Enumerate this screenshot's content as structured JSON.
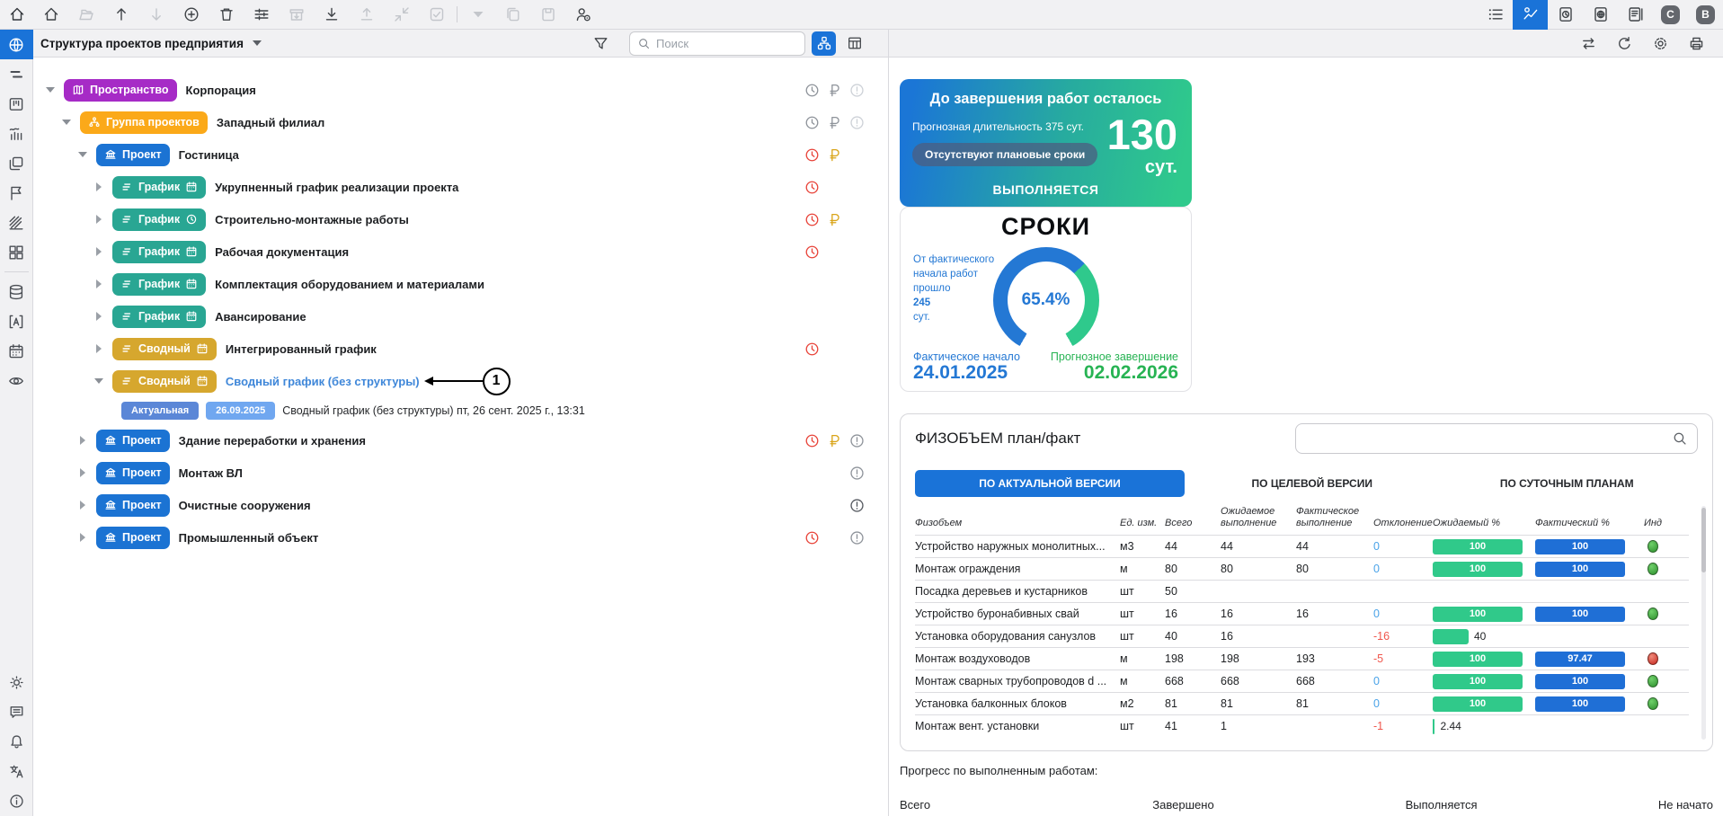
{
  "colors": {
    "accent_blue": "#1a73d8",
    "badge_purple": "#a62bc6",
    "badge_orange": "#fba919",
    "badge_blue": "#1b73d3",
    "badge_teal": "#29a693",
    "badge_gold": "#d6a72e",
    "version_badge1": "#5b87d7",
    "version_badge2": "#70a7f0",
    "link_blue": "#3f87d9",
    "status_red": "#e8443a",
    "status_grey": "#8e939a",
    "status_gold": "#d9a418",
    "warn_light": "#cdd1d7",
    "warn_grey": "#aeb3ba",
    "warn_dark": "#54585f",
    "grad_from": "#1b76d6",
    "grad_to": "#2fc98c",
    "pill_bg": "rgba(76,94,128,0.75)",
    "bar_green": "#30c98a",
    "bar_blue": "#1f6fd6",
    "blue_text": "#2478d4",
    "green_text": "#27b353"
  },
  "topbar": {
    "left": [
      {
        "name": "home",
        "state": "on"
      },
      {
        "name": "folder-open",
        "state": "off"
      },
      {
        "name": "arrow-up",
        "state": "on"
      },
      {
        "name": "arrow-down",
        "state": "off"
      },
      {
        "name": "plus-circle",
        "state": "on"
      },
      {
        "name": "trash",
        "state": "on"
      },
      {
        "name": "sliders",
        "state": "on"
      },
      {
        "name": "box-down",
        "state": "off"
      },
      {
        "name": "download",
        "state": "on"
      },
      {
        "name": "upload",
        "state": "off"
      },
      {
        "name": "collapse",
        "state": "off"
      },
      {
        "name": "checkbox",
        "state": "off"
      },
      {
        "name": "divider"
      },
      {
        "name": "caret-down",
        "state": "off",
        "small": true
      },
      {
        "name": "copy",
        "state": "off"
      },
      {
        "name": "paste",
        "state": "off"
      },
      {
        "name": "user-gear",
        "state": "on"
      }
    ],
    "right": [
      {
        "name": "list",
        "state": "on"
      },
      {
        "name": "chart-line",
        "state": "active"
      },
      {
        "name": "doc-clock",
        "state": "on"
      },
      {
        "name": "doc-globe",
        "state": "on"
      },
      {
        "name": "doc-report",
        "state": "on"
      },
      {
        "name": "badge",
        "letter": "C"
      },
      {
        "name": "badge",
        "letter": "B"
      }
    ]
  },
  "sidebar": {
    "top": [
      {
        "name": "globe",
        "active": true
      },
      {
        "name": "gantt"
      },
      {
        "name": "kanban"
      },
      {
        "name": "chart-wave"
      },
      {
        "name": "folders"
      },
      {
        "name": "flag"
      },
      {
        "name": "hatch"
      },
      {
        "name": "grid"
      },
      {
        "divider": true
      },
      {
        "name": "db"
      },
      {
        "name": "brackets-a"
      },
      {
        "name": "calendar"
      },
      {
        "name": "eye"
      }
    ],
    "bottom": [
      {
        "name": "sun"
      },
      {
        "name": "comment"
      },
      {
        "name": "bell"
      },
      {
        "name": "translate"
      },
      {
        "name": "info"
      }
    ]
  },
  "tree_panel": {
    "title": "Структура проектов предприятия",
    "search_placeholder": "Поиск",
    "annotation_label": "1",
    "rows": [
      {
        "lvl": 0,
        "caret": "down",
        "badge": "Пространство",
        "color": "badge_purple",
        "icon": "map",
        "name": "Корпорация",
        "status": {
          "clock": "grey",
          "ruble": "grey",
          "warn": "light"
        }
      },
      {
        "lvl": 1,
        "caret": "down",
        "badge": "Группа проектов",
        "color": "badge_orange",
        "icon": "hierarchy",
        "name": "Западный филиал",
        "status": {
          "clock": "grey",
          "ruble": "grey",
          "warn": "light"
        }
      },
      {
        "lvl": 2,
        "caret": "down",
        "badge": "Проект",
        "color": "badge_blue",
        "icon": "bank",
        "name": "Гостиница",
        "status": {
          "clock": "red",
          "ruble": "gold"
        }
      },
      {
        "lvl": 3,
        "caret": "right",
        "badge": "График",
        "color": "badge_teal",
        "icon": "bars",
        "icon2": "calendar",
        "name": "Укрупненный график реализации проекта",
        "status": {
          "clock": "red"
        }
      },
      {
        "lvl": 3,
        "caret": "right",
        "badge": "График",
        "color": "badge_teal",
        "icon": "bars",
        "icon2": "clock-small",
        "name": "Строительно-монтажные работы",
        "status": {
          "clock": "red",
          "ruble": "gold"
        }
      },
      {
        "lvl": 3,
        "caret": "right",
        "badge": "График",
        "color": "badge_teal",
        "icon": "bars",
        "icon2": "calendar",
        "name": "Рабочая документация",
        "status": {
          "clock": "red"
        }
      },
      {
        "lvl": 3,
        "caret": "right",
        "badge": "График",
        "color": "badge_teal",
        "icon": "bars",
        "icon2": "calendar",
        "name": "Комплектация оборудованием и материалами"
      },
      {
        "lvl": 3,
        "caret": "right",
        "badge": "График",
        "color": "badge_teal",
        "icon": "bars",
        "icon2": "calendar",
        "name": "Авансирование"
      },
      {
        "lvl": 3,
        "caret": "right",
        "badge": "Сводный",
        "color": "badge_gold",
        "icon": "bars",
        "icon2": "calendar",
        "name": "Интегрированный график",
        "status": {
          "clock": "red"
        }
      },
      {
        "lvl": 3,
        "caret": "down",
        "badge": "Сводный",
        "color": "badge_gold",
        "icon": "bars",
        "icon2": "calendar",
        "name": "Сводный график (без структуры)",
        "link": true,
        "annotation": "1"
      },
      {
        "lvl": 4,
        "version": true,
        "badge1": "Актуальная",
        "badge2": "26.09.2025",
        "name": "Сводный график (без структуры) пт, 26 сент. 2025 г., 13:31"
      },
      {
        "lvl": 2,
        "caret": "right",
        "badge": "Проект",
        "color": "badge_blue",
        "icon": "bank",
        "name": "Здание переработки и хранения",
        "status": {
          "clock": "red",
          "ruble": "gold",
          "warn": "grey"
        }
      },
      {
        "lvl": 2,
        "caret": "right",
        "badge": "Проект",
        "color": "badge_blue",
        "icon": "bank",
        "name": "Монтаж ВЛ",
        "status": {
          "warn": "grey"
        }
      },
      {
        "lvl": 2,
        "caret": "right",
        "badge": "Проект",
        "color": "badge_blue",
        "icon": "bank",
        "name": "Очистные сооружения",
        "status": {
          "warn": "dark"
        }
      },
      {
        "lvl": 2,
        "caret": "right",
        "badge": "Проект",
        "color": "badge_blue",
        "icon": "bank",
        "name": "Промышленный объект",
        "status": {
          "clock": "red",
          "warn": "grey"
        }
      }
    ]
  },
  "dashboard": {
    "countdown": {
      "title": "До завершения работ осталось",
      "forecast": "Прогнозная длительность 375 сут.",
      "pill": "Отсутствуют плановые сроки",
      "days": "130",
      "days_unit": "сут.",
      "status": "ВЫПОЛНЯЕТСЯ"
    },
    "sroki": {
      "title": "СРОКИ",
      "left_lines": [
        "От фактического",
        "начала работ",
        "прошло"
      ],
      "elapsed": "245",
      "elapsed_unit": "сут.",
      "percent": 65.4,
      "percent_label": "65.4%",
      "start_label": "Фактическое начало",
      "start_date": "24.01.2025",
      "end_label": "Прогнозное завершение",
      "end_date": "02.02.2026"
    },
    "fizobem": {
      "title": "ФИЗОБЪЕМ план/факт",
      "search_value": "",
      "tabs": [
        {
          "label": "ПО АКТУАЛЬНОЙ ВЕРСИИ",
          "active": true
        },
        {
          "label": "ПО ЦЕЛЕВОЙ ВЕРСИИ",
          "active": false
        },
        {
          "label": "ПО СУТОЧНЫМ ПЛАНАМ",
          "active": false
        }
      ],
      "columns": [
        "Физобъем",
        "Ед. изм.",
        "Всего",
        "Ожидаемое\nвыполнение",
        "Фактическое\nвыполнение",
        "Отклонение",
        "Ожидаемый %",
        "Фактический %",
        "Инд"
      ],
      "rows": [
        {
          "name": "Устройство наружных монолитных...",
          "unit": "м3",
          "total": "44",
          "expected": "44",
          "actual": "44",
          "deviation": "0",
          "expected_pct": 100,
          "actual_pct": 100,
          "actual_pct_label": "100",
          "ind": "green"
        },
        {
          "name": "Монтаж ограждения",
          "unit": "м",
          "total": "80",
          "expected": "80",
          "actual": "80",
          "deviation": "0",
          "expected_pct": 100,
          "actual_pct": 100,
          "actual_pct_label": "100",
          "ind": "green"
        },
        {
          "name": "Посадка деревьев и кустарников",
          "unit": "шт",
          "total": "50",
          "expected": "",
          "actual": "",
          "deviation": "",
          "expected_pct": null,
          "actual_pct": null,
          "ind": null
        },
        {
          "name": "Устройство буронабивных свай",
          "unit": "шт",
          "total": "16",
          "expected": "16",
          "actual": "16",
          "deviation": "0",
          "expected_pct": 100,
          "actual_pct": 100,
          "actual_pct_label": "100",
          "ind": "green"
        },
        {
          "name": "Установка оборудования санузлов",
          "unit": "шт",
          "total": "40",
          "expected": "16",
          "actual": "",
          "deviation": "-16",
          "expected_pct": 40,
          "expected_pct_label": "40",
          "actual_pct": null,
          "ind": null
        },
        {
          "name": "Монтаж воздуховодов",
          "unit": "м",
          "total": "198",
          "expected": "198",
          "actual": "193",
          "deviation": "-5",
          "expected_pct": 100,
          "actual_pct": 97.47,
          "actual_pct_label": "97.47",
          "ind": "red"
        },
        {
          "name": "Монтаж сварных трубопроводов d ...",
          "unit": "м",
          "total": "668",
          "expected": "668",
          "actual": "668",
          "deviation": "0",
          "expected_pct": 100,
          "actual_pct": 100,
          "actual_pct_label": "100",
          "ind": "green"
        },
        {
          "name": "Установка балконных блоков",
          "unit": "м2",
          "total": "81",
          "expected": "81",
          "actual": "81",
          "deviation": "0",
          "expected_pct": 100,
          "actual_pct": 100,
          "actual_pct_label": "100",
          "ind": "green"
        },
        {
          "name": "Монтаж вент. установки",
          "unit": "шт",
          "total": "41",
          "expected": "1",
          "actual": "",
          "deviation": "-1",
          "expected_pct": 2.44,
          "expected_pct_label": "2.44",
          "actual_pct": null,
          "ind": null
        }
      ]
    },
    "progress": {
      "title": "Прогресс по выполненным работам:",
      "labels": [
        "Всего",
        "Завершено",
        "Выполняется",
        "Не начато"
      ]
    }
  }
}
